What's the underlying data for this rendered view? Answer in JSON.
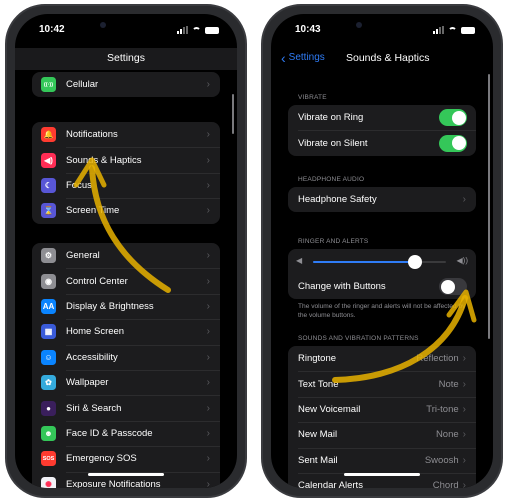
{
  "left_phone": {
    "status": {
      "time": "10:42"
    },
    "nav": {
      "title": "Settings"
    },
    "groups": [
      [
        {
          "label": "Cellular",
          "icon": "cellular-icon",
          "glyph": "((·))",
          "color": "#34c759"
        }
      ],
      [
        {
          "label": "Notifications",
          "icon": "bell-icon",
          "glyph": "🔔",
          "color": "#ff3b30"
        },
        {
          "label": "Sounds & Haptics",
          "icon": "speaker-icon",
          "glyph": "◀)",
          "color": "#ff2d55"
        },
        {
          "label": "Focus",
          "icon": "moon-icon",
          "glyph": "☾",
          "color": "#5856d6"
        },
        {
          "label": "Screen Time",
          "icon": "hourglass-icon",
          "glyph": "⌛",
          "color": "#5856d6"
        }
      ],
      [
        {
          "label": "General",
          "icon": "gear-icon",
          "glyph": "⚙",
          "color": "#8e8e93"
        },
        {
          "label": "Control Center",
          "icon": "switches-icon",
          "glyph": "◉",
          "color": "#8e8e93"
        },
        {
          "label": "Display & Brightness",
          "icon": "text-size-icon",
          "glyph": "AA",
          "color": "#0a84ff"
        },
        {
          "label": "Home Screen",
          "icon": "grid-icon",
          "glyph": "▦",
          "color": "#3a5bd9"
        },
        {
          "label": "Accessibility",
          "icon": "accessibility-icon",
          "glyph": "☺",
          "color": "#0a84ff"
        },
        {
          "label": "Wallpaper",
          "icon": "flower-icon",
          "glyph": "✿",
          "color": "#34aadc"
        },
        {
          "label": "Siri & Search",
          "icon": "siri-icon",
          "glyph": "●",
          "color": "#3a1f5c"
        },
        {
          "label": "Face ID & Passcode",
          "icon": "face-id-icon",
          "glyph": "☻",
          "color": "#34c759"
        },
        {
          "label": "Emergency SOS",
          "icon": "sos-icon",
          "glyph": "SOS",
          "color": "#ff3b30"
        },
        {
          "label": "Exposure Notifications",
          "icon": "exposure-icon",
          "glyph": "✺",
          "color": "#f2f2f7"
        }
      ]
    ]
  },
  "right_phone": {
    "status": {
      "time": "10:43"
    },
    "nav": {
      "back_label": "Settings",
      "title": "Sounds & Haptics"
    },
    "vibrate": {
      "header": "VIBRATE",
      "rows": [
        {
          "label": "Vibrate on Ring",
          "on": true
        },
        {
          "label": "Vibrate on Silent",
          "on": true
        }
      ]
    },
    "headphone": {
      "header": "HEADPHONE AUDIO",
      "rows": [
        {
          "label": "Headphone Safety"
        }
      ]
    },
    "ringer": {
      "header": "RINGER AND ALERTS",
      "volume_level": 0.77,
      "change_with_buttons": {
        "label": "Change with Buttons",
        "on": false
      },
      "footnote": "The volume of the ringer and alerts will not be affected by the volume buttons."
    },
    "patterns": {
      "header": "SOUNDS AND VIBRATION PATTERNS",
      "rows": [
        {
          "label": "Ringtone",
          "value": "Reflection"
        },
        {
          "label": "Text Tone",
          "value": "Note"
        },
        {
          "label": "New Voicemail",
          "value": "Tri-tone"
        },
        {
          "label": "New Mail",
          "value": "None"
        },
        {
          "label": "Sent Mail",
          "value": "Swoosh"
        },
        {
          "label": "Calendar Alerts",
          "value": "Chord"
        }
      ]
    }
  },
  "annotation_color": "#e8b100"
}
